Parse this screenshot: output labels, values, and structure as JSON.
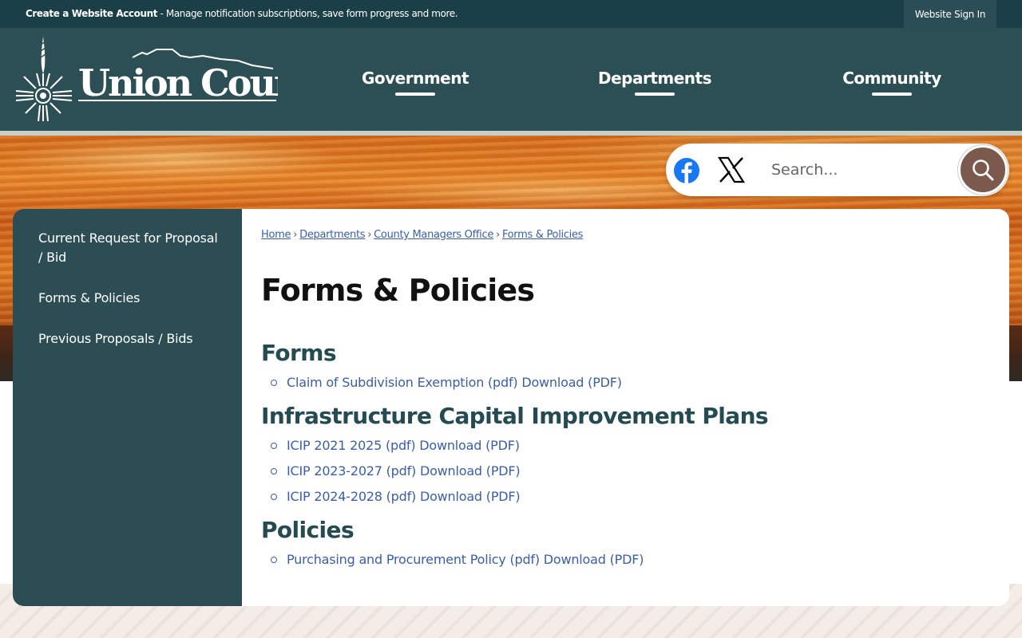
{
  "topbar": {
    "create_account_bold": "Create a Website Account",
    "create_account_rest": " - Manage notification subscriptions, save form progress and more.",
    "signin_label": "Website Sign In"
  },
  "header": {
    "logo_text": "Union County",
    "nav": [
      {
        "label": "Government"
      },
      {
        "label": "Departments"
      },
      {
        "label": "Community"
      }
    ]
  },
  "search": {
    "placeholder": "Search..."
  },
  "sidebar": {
    "items": [
      {
        "label": "Current Request for Proposal / Bid"
      },
      {
        "label": "Forms & Policies"
      },
      {
        "label": "Previous Proposals / Bids"
      }
    ]
  },
  "breadcrumb": {
    "items": [
      "Home",
      "Departments",
      "County Managers Office",
      "Forms & Policies"
    ],
    "separator": "›"
  },
  "page": {
    "title": "Forms & Policies",
    "sections": [
      {
        "heading": "Forms",
        "links": [
          "Claim of Subdivision Exemption (pdf) Download (PDF)"
        ]
      },
      {
        "heading": "Infrastructure Capital Improvement Plans",
        "links": [
          "ICIP 2021 2025 (pdf) Download (PDF)",
          "ICIP 2023-2027 (pdf) Download (PDF)",
          "ICIP 2024-2028 (pdf) Download (PDF)"
        ]
      },
      {
        "heading": "Policies",
        "links": [
          "Purchasing and Procurement Policy (pdf) Download (PDF)"
        ]
      }
    ]
  },
  "colors": {
    "header_bg": "#2b4f55",
    "topbar_bg": "#1b3f47",
    "sidebar_bg": "#2b4d53",
    "link": "#3a5ea8",
    "section_heading": "#244a52",
    "search_button": "#7b5a4d",
    "facebook": "#1877f2"
  },
  "icons": [
    "zia-sun-logo",
    "facebook-icon",
    "x-icon",
    "search-icon"
  ]
}
